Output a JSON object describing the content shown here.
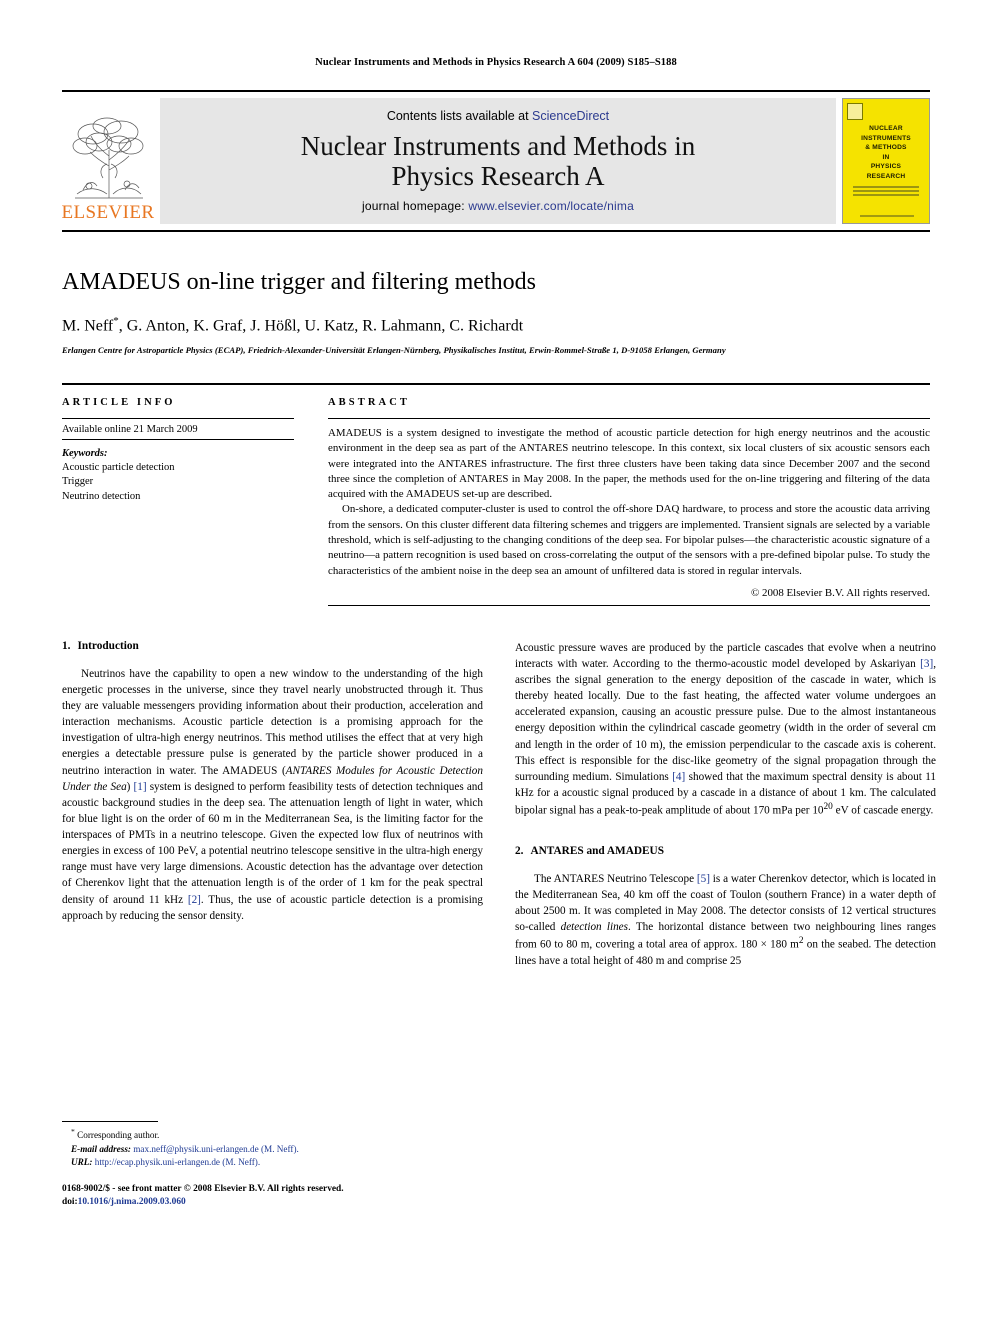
{
  "running_head": "Nuclear Instruments and Methods in Physics Research A 604 (2009) S185–S188",
  "masthead": {
    "elsevier_wordmark": "ELSEVIER",
    "contents_prefix": "Contents lists available at ",
    "contents_link": "ScienceDirect",
    "journal_title_line1": "Nuclear Instruments and Methods in",
    "journal_title_line2": "Physics Research A",
    "homepage_prefix": "journal homepage: ",
    "homepage_url": "www.elsevier.com/locate/nima",
    "cover_title": "NUCLEAR\nINSTRUMENTS\n& METHODS\nIN\nPHYSICS\nRESEARCH",
    "cover_colors": {
      "background": "#F5E300",
      "text": "#1b1b00"
    }
  },
  "title_block": {
    "title": "AMADEUS on-line trigger and filtering methods",
    "authors": "M. Neff",
    "authors_rest": ", G. Anton, K. Graf, J. Hößl, U. Katz, R. Lahmann, C. Richardt",
    "corresponding_marker": "*",
    "affiliation": "Erlangen Centre for Astroparticle Physics (ECAP), Friedrich-Alexander-Universität Erlangen-Nürnberg, Physikalisches Institut, Erwin-Rommel-Straße 1, D-91058 Erlangen, Germany"
  },
  "article_info": {
    "kicker": "ARTICLE INFO",
    "history": "Available online 21 March 2009",
    "keywords_label": "Keywords:",
    "keywords": [
      "Acoustic particle detection",
      "Trigger",
      "Neutrino detection"
    ]
  },
  "abstract": {
    "kicker": "ABSTRACT",
    "paragraph1": "AMADEUS is a system designed to investigate the method of acoustic particle detection for high energy neutrinos and the acoustic environment in the deep sea as part of the ANTARES neutrino telescope. In this context, six local clusters of six acoustic sensors each were integrated into the ANTARES infrastructure. The first three clusters have been taking data since December 2007 and the second three since the completion of ANTARES in May 2008. In the paper, the methods used for the on-line triggering and filtering of the data acquired with the AMADEUS set-up are described.",
    "paragraph2": "On-shore, a dedicated computer-cluster is used to control the off-shore DAQ hardware, to process and store the acoustic data arriving from the sensors. On this cluster different data filtering schemes and triggers are implemented. Transient signals are selected by a variable threshold, which is self-adjusting to the changing conditions of the deep sea. For bipolar pulses—the characteristic acoustic signature of a neutrino—a pattern recognition is used based on cross-correlating the output of the sensors with a pre-defined bipolar pulse. To study the characteristics of the ambient noise in the deep sea an amount of unfiltered data is stored in regular intervals.",
    "copyright": "© 2008 Elsevier B.V. All rights reserved."
  },
  "sections": {
    "intro": {
      "number": "1.",
      "heading": "Introduction",
      "p1_part1": "Neutrinos have the capability to open a new window to the understanding of the high energetic processes in the universe, since they travel nearly unobstructed through it. Thus they are valuable messengers providing information about their production, acceleration and interaction mechanisms. Acoustic particle detection is a promising approach for the investigation of ultra-high energy neutrinos. This method utilises the effect that at very high energies a detectable pressure pulse is generated by the particle shower produced in a neutrino interaction in water. The AMADEUS (",
      "p1_italic1": "ANTARES Modules for Acoustic Detection Under the Sea",
      "p1_part2": ") ",
      "p1_ref1": "[1]",
      "p1_part3": " system is designed to perform feasibility tests of detection techniques and acoustic background studies in the deep sea. The attenuation length of light in water, which for blue light is on the order of 60 m in the Mediterranean Sea, is the limiting factor for the interspaces of PMTs in a neutrino telescope. Given the expected low flux of neutrinos with energies in excess of 100 PeV, a potential neutrino telescope sensitive in the ultra-high energy range must have very large dimensions. Acoustic detection has the advantage over detection of Cherenkov light that the attenuation length is of the order of 1 km for the peak spectral density of around 11 kHz ",
      "p1_ref2": "[2]",
      "p1_part4": ". Thus, the use of acoustic particle detection is a promising approach by reducing the sensor density.",
      "p2_part1": "Acoustic pressure waves are produced by the particle cascades that evolve when a neutrino interacts with water. According to the thermo-acoustic model developed by Askariyan ",
      "p2_ref1": "[3]",
      "p2_part2": ", ascribes the signal generation to the energy deposition of the cascade in water, which is thereby heated locally. Due to the fast heating, the affected water volume undergoes an accelerated expansion, causing an acoustic pressure pulse. Due to the almost instantaneous energy deposition within the cylindrical cascade geometry (width in the order of several cm and length in the order of 10 m), the emission perpendicular to the cascade axis is coherent. This effect is responsible for the disc-like geometry of the signal propagation through the surrounding medium. Simulations ",
      "p2_ref2": "[4]",
      "p2_part3": " showed that the maximum spectral density is about 11 kHz for a acoustic signal produced by a cascade in a distance of about 1 km. The calculated bipolar signal has a peak-to-peak amplitude of about 170 mPa per 10",
      "p2_sup": "20",
      "p2_part4": " eV of cascade energy."
    },
    "antares": {
      "number": "2.",
      "heading": "ANTARES and AMADEUS",
      "p1_part1": "The ANTARES Neutrino Telescope ",
      "p1_ref1": "[5]",
      "p1_part2": " is a water Cherenkov detector, which is located in the Mediterranean Sea, 40 km off the coast of Toulon (southern France) in a water depth of about 2500 m. It was completed in May 2008. The detector consists of 12 vertical structures so-called ",
      "p1_italic1": "detection lines",
      "p1_part3": ". The horizontal distance between two neighbouring lines ranges from 60 to 80 m, covering a total area of approx. 180 × 180 m",
      "p1_sup": "2",
      "p1_part4": " on the seabed. The detection lines have a total height of 480 m and comprise 25"
    }
  },
  "footnote": {
    "corresponding": "Corresponding author.",
    "email_label": "E-mail address:",
    "email": "max.neff@physik.uni-erlangen.de (M. Neff).",
    "url_label": "URL:",
    "url": "http://ecap.physik.uni-erlangen.de (M. Neff)."
  },
  "imprint": {
    "issn_line": "0168-9002/$ - see front matter © 2008 Elsevier B.V. All rights reserved.",
    "doi_label": "doi:",
    "doi": "10.1016/j.nima.2009.03.060"
  }
}
